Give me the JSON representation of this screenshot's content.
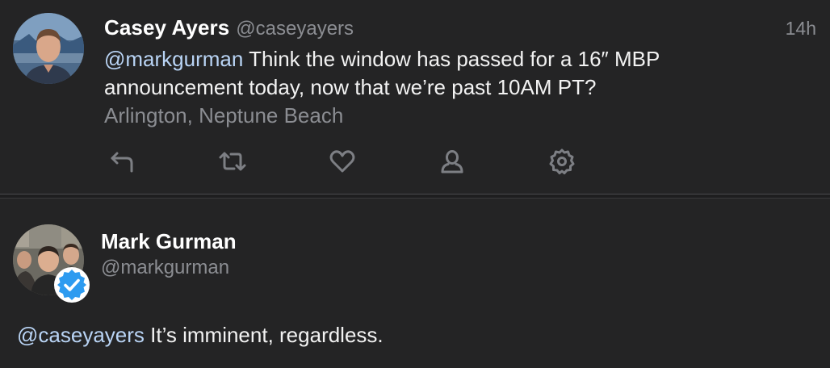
{
  "tweet": {
    "author_name": "Casey Ayers",
    "author_handle": "@caseyayers",
    "time": "14h",
    "mention": "@markgurman",
    "text": " Think the window has passed for a 16″ MBP announcement today, now that we’re past 10AM PT?",
    "location": "Arlington, Neptune Beach",
    "actions": [
      "reply-icon",
      "retweet-icon",
      "like-icon",
      "profile-icon",
      "settings-icon"
    ]
  },
  "reply": {
    "author_name": "Mark Gurman",
    "author_handle": "@markgurman",
    "verified": true,
    "mention": "@caseyayers",
    "text": " It’s imminent, regardless."
  },
  "colors": {
    "background": "#242425",
    "mention": "#b9d4f5",
    "secondary_text": "#8b8d92",
    "icon": "#7d7f84",
    "verified_badge": "#2d9bf0"
  }
}
